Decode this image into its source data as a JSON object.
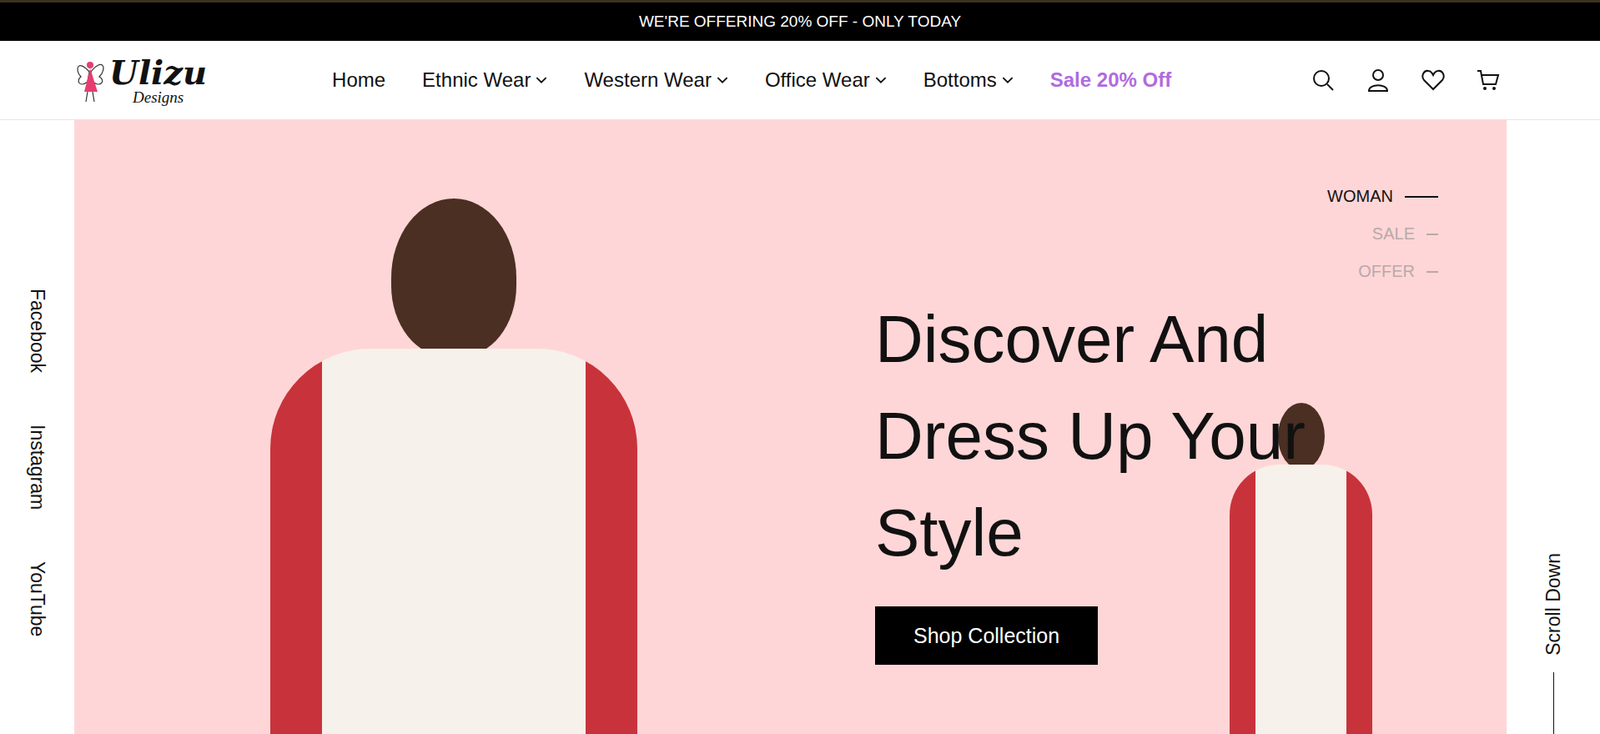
{
  "announcement": "WE'RE OFFERING 20% OFF - ONLY TODAY",
  "logo": {
    "name": "Ulizu",
    "tagline": "Designs"
  },
  "nav": [
    {
      "label": "Home",
      "dropdown": false,
      "highlighted": false
    },
    {
      "label": "Ethnic Wear",
      "dropdown": true,
      "highlighted": false
    },
    {
      "label": "Western Wear",
      "dropdown": true,
      "highlighted": false
    },
    {
      "label": "Office Wear",
      "dropdown": true,
      "highlighted": false
    },
    {
      "label": "Bottoms",
      "dropdown": true,
      "highlighted": false
    },
    {
      "label": "Sale 20% Off",
      "dropdown": false,
      "highlighted": true
    }
  ],
  "social": [
    "Facebook",
    "Instagram",
    "YouTube"
  ],
  "hero": {
    "categories": [
      {
        "label": "WOMAN",
        "selected": true
      },
      {
        "label": "SALE",
        "selected": false
      },
      {
        "label": "OFFER",
        "selected": false
      }
    ],
    "heading": "Discover And Dress Up Your Style",
    "button": "Shop Collection"
  },
  "scroll": "Scroll Down"
}
